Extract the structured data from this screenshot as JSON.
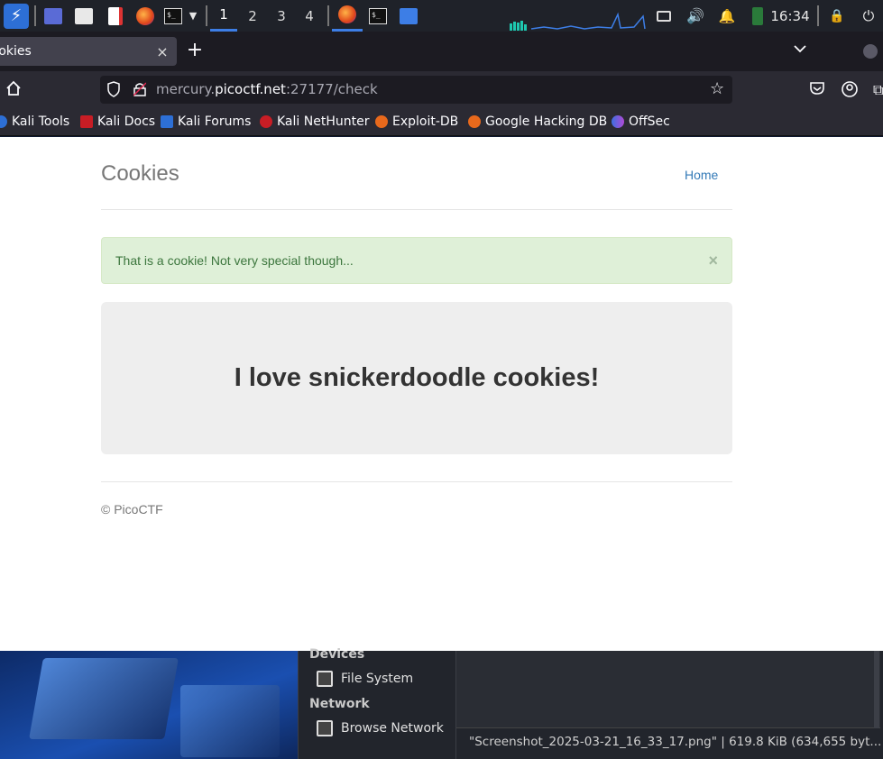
{
  "panel": {
    "workspaces": [
      "1",
      "2",
      "3",
      "4"
    ],
    "active_workspace": "1",
    "clock": "16:34",
    "icons": [
      "kali-menu-icon",
      "desktop-icon",
      "files-icon",
      "text-editor-icon",
      "firefox-icon",
      "terminal-icon",
      "chevron-down-icon",
      "firefox-window-icon",
      "terminal-window-icon",
      "file-manager-window-icon",
      "display-icon",
      "volume-icon",
      "bell-icon",
      "battery-icon",
      "lock-icon",
      "logout-icon"
    ]
  },
  "browser": {
    "tab_title": "Cookies",
    "tab_close": "×",
    "new_tab": "+",
    "tablist": "⌄",
    "url_prefix": "mercury.",
    "url_host": "picoctf.net",
    "url_suffix": ":27177/check",
    "bookmarks": [
      "Kali Tools",
      "Kali Docs",
      "Kali Forums",
      "Kali NetHunter",
      "Exploit-DB",
      "Google Hacking DB",
      "OffSec"
    ]
  },
  "page": {
    "site_title": "Cookies",
    "nav_home": "Home",
    "alert_text": "That is a cookie! Not very special though...",
    "alert_close": "×",
    "jumbotron_text": "I love snickerdoodle cookies!",
    "footer": "© PicoCTF"
  },
  "file_manager": {
    "devices_header": "Devices",
    "file_system": "File System",
    "network_header": "Network",
    "browse_network": "Browse Network",
    "status": "\"Screenshot_2025-03-21_16_33_17.png\" | 619.8 KiB (634,655 byt..."
  },
  "colors": {
    "accent": "#3d7ee6",
    "link": "#337ab7",
    "alert_bg": "#dff0d8",
    "alert_text": "#3c763d",
    "jumbotron_bg": "#eeeeee"
  }
}
